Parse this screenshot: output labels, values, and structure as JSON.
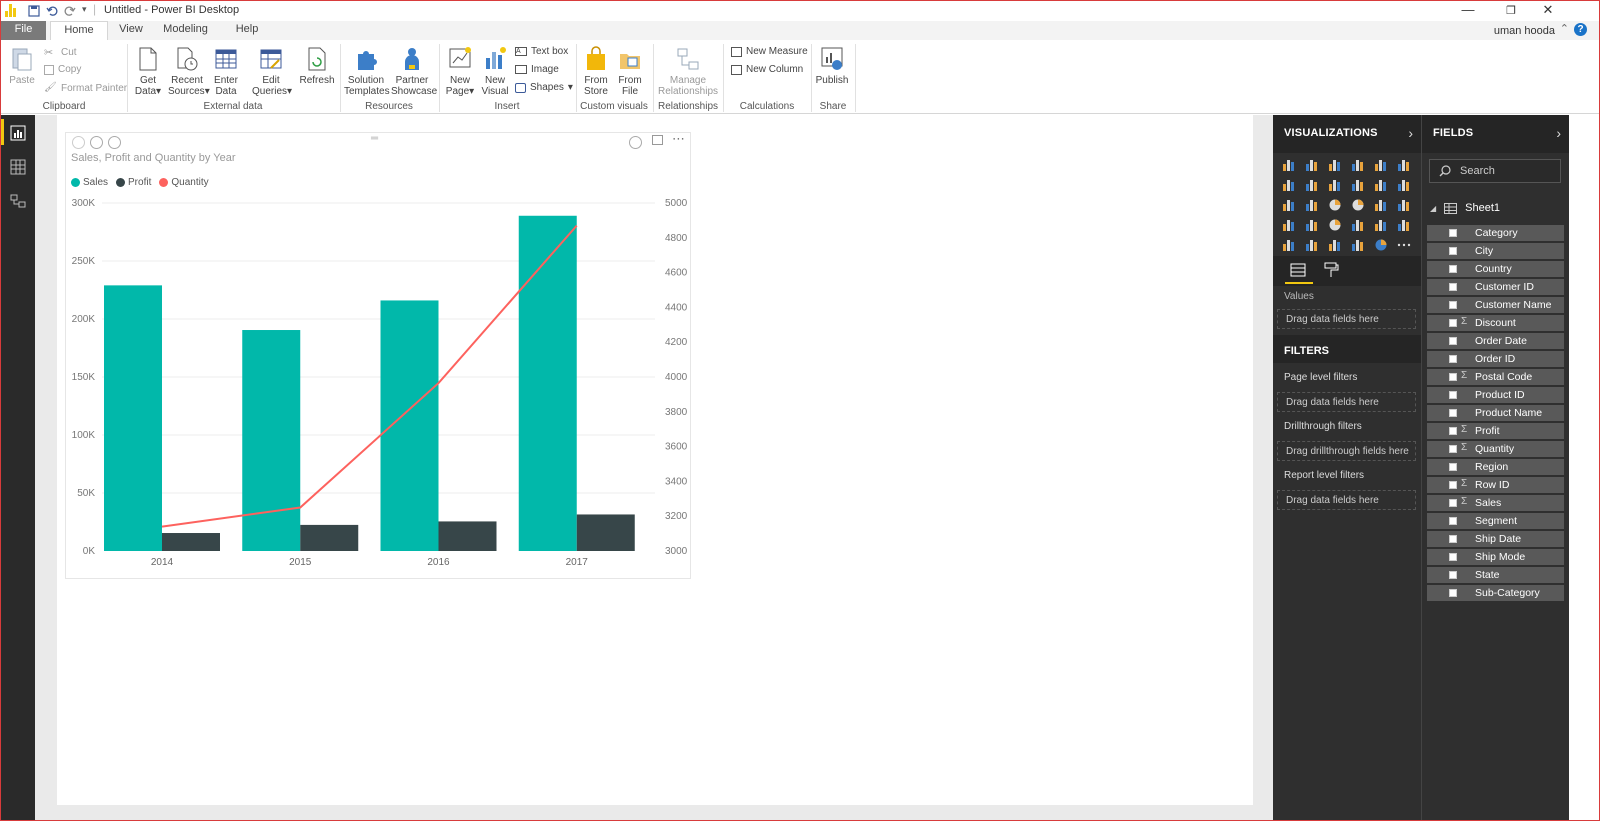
{
  "window": {
    "title": "Untitled - Power BI Desktop",
    "user": "uman hooda",
    "controls": [
      "minimize-icon",
      "restore-icon",
      "close-icon"
    ]
  },
  "ribbon_tabs": [
    "File",
    "Home",
    "View",
    "Modeling",
    "Help"
  ],
  "ribbon": {
    "clipboard": {
      "paste": "Paste",
      "cut": "Cut",
      "copy": "Copy",
      "format_painter": "Format Painter",
      "label": "Clipboard"
    },
    "external": {
      "get_data": "Get",
      "get_data2": "Data",
      "recent": "Recent",
      "recent2": "Sources",
      "enter": "Enter",
      "enter2": "Data",
      "edit": "Edit",
      "edit2": "Queries",
      "refresh": "Refresh",
      "label": "External data"
    },
    "resources": {
      "solution": "Solution",
      "solution2": "Templates",
      "partner": "Partner",
      "partner2": "Showcase",
      "label": "Resources"
    },
    "insert": {
      "new_page": "New",
      "new_page2": "Page",
      "new_visual": "New",
      "new_visual2": "Visual",
      "text_box": "Text box",
      "image": "Image",
      "shapes": "Shapes",
      "label": "Insert"
    },
    "custom": {
      "from_store": "From",
      "from_store2": "Store",
      "from_file": "From",
      "from_file2": "File",
      "label": "Custom visuals"
    },
    "relationships": {
      "manage": "Manage",
      "manage2": "Relationships",
      "label": "Relationships"
    },
    "calculations": {
      "new_measure": "New Measure",
      "new_column": "New Column",
      "label": "Calculations"
    },
    "share": {
      "publish": "Publish",
      "label": "Share"
    }
  },
  "colors": {
    "sales": "#01b8aa",
    "profit": "#374649",
    "quantity": "#fd625e",
    "accent": "#f2c811"
  },
  "chart_data": {
    "type": "bar",
    "title": "Sales, Profit and Quantity by Year",
    "categories": [
      "2014",
      "2015",
      "2016",
      "2017"
    ],
    "series": [
      {
        "name": "Sales",
        "type": "bar",
        "axis": "left",
        "values": [
          229000,
          190500,
          216000,
          289000
        ]
      },
      {
        "name": "Profit",
        "type": "bar",
        "axis": "left",
        "values": [
          15500,
          22500,
          25500,
          31500
        ]
      },
      {
        "name": "Quantity",
        "type": "line",
        "axis": "right",
        "values": [
          3140,
          3250,
          3965,
          4870
        ]
      }
    ],
    "y_left": {
      "ticks": [
        "0K",
        "50K",
        "100K",
        "150K",
        "200K",
        "250K",
        "300K"
      ],
      "range": [
        0,
        300000
      ]
    },
    "y_right": {
      "ticks": [
        "3000",
        "3200",
        "3400",
        "3600",
        "3800",
        "4000",
        "4200",
        "4400",
        "4600",
        "4800",
        "5000"
      ],
      "range": [
        3000,
        5000
      ]
    },
    "legend_position": "top-left",
    "grid": true
  },
  "visualizations": {
    "title": "VISUALIZATIONS",
    "values_label": "Values",
    "drop_values": "Drag data fields here",
    "filters_title": "FILTERS",
    "page_filters": "Page level filters",
    "drop_page": "Drag data fields here",
    "drill_filters": "Drillthrough filters",
    "drop_drill": "Drag drillthrough fields here",
    "report_filters": "Report level filters",
    "drop_report": "Drag data fields here"
  },
  "fields": {
    "title": "FIELDS",
    "search_placeholder": "Search",
    "table": "Sheet1",
    "items": [
      {
        "name": "Category",
        "sigma": ""
      },
      {
        "name": "City",
        "sigma": ""
      },
      {
        "name": "Country",
        "sigma": ""
      },
      {
        "name": "Customer ID",
        "sigma": ""
      },
      {
        "name": "Customer Name",
        "sigma": ""
      },
      {
        "name": "Discount",
        "sigma": "Σ"
      },
      {
        "name": "Order Date",
        "sigma": ""
      },
      {
        "name": "Order ID",
        "sigma": ""
      },
      {
        "name": "Postal Code",
        "sigma": "Σ"
      },
      {
        "name": "Product ID",
        "sigma": ""
      },
      {
        "name": "Product Name",
        "sigma": ""
      },
      {
        "name": "Profit",
        "sigma": "Σ"
      },
      {
        "name": "Quantity",
        "sigma": "Σ"
      },
      {
        "name": "Region",
        "sigma": ""
      },
      {
        "name": "Row ID",
        "sigma": "Σ"
      },
      {
        "name": "Sales",
        "sigma": "Σ"
      },
      {
        "name": "Segment",
        "sigma": ""
      },
      {
        "name": "Ship Date",
        "sigma": ""
      },
      {
        "name": "Ship Mode",
        "sigma": ""
      },
      {
        "name": "State",
        "sigma": ""
      },
      {
        "name": "Sub-Category",
        "sigma": ""
      }
    ]
  }
}
